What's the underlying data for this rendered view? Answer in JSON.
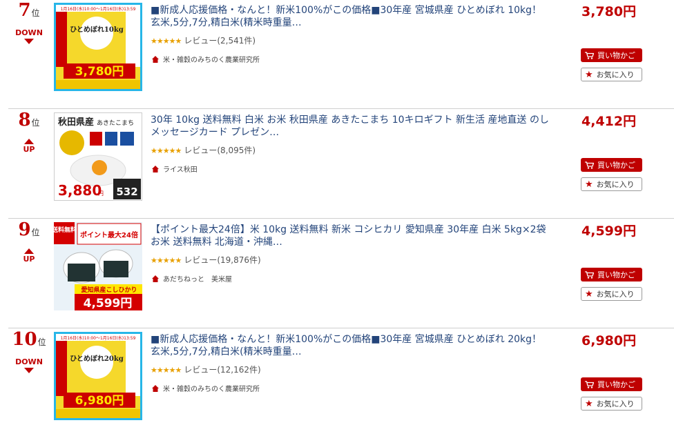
{
  "colors": {
    "accent": "#bf0000",
    "link": "#23447a",
    "star": "#e8a000"
  },
  "items": [
    {
      "rank": "7",
      "rank_suffix": "位",
      "trend": "DOWN",
      "title": "■新成人応援価格・なんと！新米100%がこの価格■30年産 宮城県産 ひとめぼれ 10kg！玄米,5分,7分,精白米(精米時重量…",
      "stars": "★★★★★",
      "review_label": "レビュー(2,541件)",
      "shop": "米・雑穀のみちのく農業研究所",
      "price": "3,780円",
      "cart_label": "買い物かご",
      "fav_label": "お気に入り",
      "thumb": {
        "banner": "1月16日(水)10:00～1月16日(水)13:59",
        "product": "ひとめぼれ10kg",
        "price": "3,780円"
      }
    },
    {
      "rank": "8",
      "rank_suffix": "位",
      "trend": "UP",
      "title": "30年 10kg 送料無料 白米 お米 秋田県産 あきたこまち 10キロギフト 新生活 産地直送 のし メッセージカード プレゼン…",
      "stars": "★★★★★",
      "review_label": "レビュー(8,095件)",
      "shop": "ライス秋田",
      "price": "4,412円",
      "cart_label": "買い物かご",
      "fav_label": "お気に入り",
      "thumb": {
        "heading": "秋田県産",
        "variety": "あきたこまち",
        "price": "3,880",
        "unit": "円",
        "coupon": "532"
      }
    },
    {
      "rank": "9",
      "rank_suffix": "位",
      "trend": "UP",
      "title": "【ポイント最大24倍】米 10kg 送料無料 新米 コシヒカリ 愛知県産 30年産 白米 5kg×2袋 お米 送料無料 北海道・沖縄…",
      "stars": "★★★★★",
      "review_label": "レビュー(19,876件)",
      "shop": "あだちねっと　美米屋",
      "price": "4,599円",
      "cart_label": "買い物かご",
      "fav_label": "お気に入り",
      "thumb": {
        "free": "送料無料",
        "point": "ポイント最大24倍",
        "variety": "愛知県産こしひかり",
        "price": "4,599円"
      }
    },
    {
      "rank": "10",
      "rank_suffix": "位",
      "trend": "DOWN",
      "title": "■新成人応援価格・なんと！新米100%がこの価格■30年産 宮城県産 ひとめぼれ 20kg！玄米,5分,7分,精白米(精米時重量…",
      "stars": "★★★★★",
      "review_label": "レビュー(12,162件)",
      "shop": "米・雑穀のみちのく農業研究所",
      "price": "6,980円",
      "cart_label": "買い物かご",
      "fav_label": "お気に入り",
      "thumb": {
        "banner": "1月16日(水)10:00～1月16日(水)13:59",
        "product": "ひとめぼれ20kg",
        "price": "6,980円"
      }
    }
  ]
}
